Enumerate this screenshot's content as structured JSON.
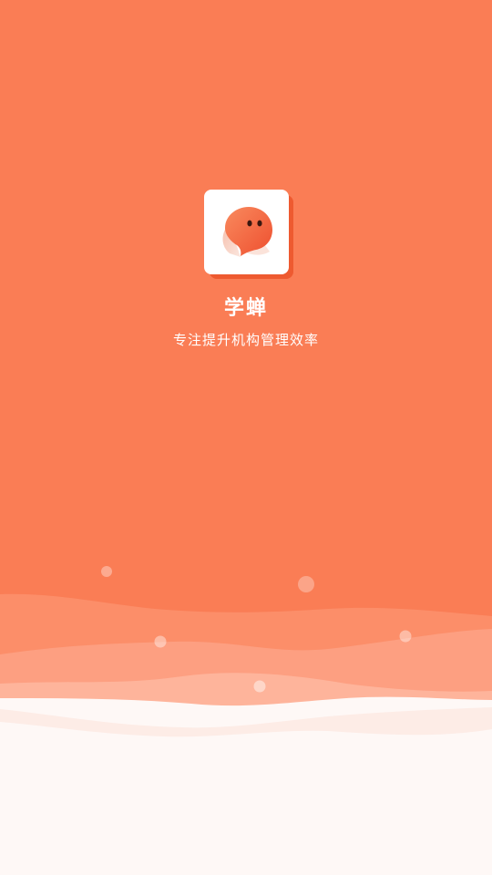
{
  "app": {
    "name": "学蝉",
    "tagline": "专注提升机构管理效率"
  },
  "colors": {
    "background": "#fa7d55",
    "logo_card": "#ffffff",
    "logo_shadow": "#ee5a30",
    "mascot": "#f26a45",
    "footer": "#fef8f6"
  },
  "icons": {
    "logo": "chat-bubble-mascot-icon"
  }
}
